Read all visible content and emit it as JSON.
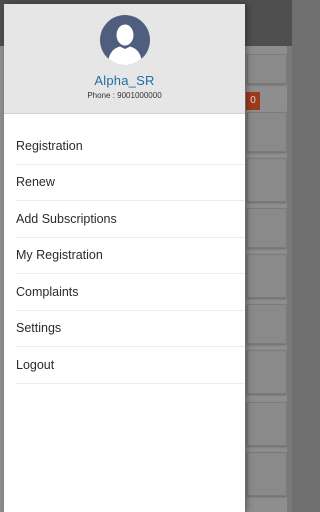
{
  "drawer": {
    "user": {
      "name": "Alpha_SR",
      "phone": "Phone : 9001000000"
    },
    "menu_items": [
      {
        "label": "Registration"
      },
      {
        "label": "Renew"
      },
      {
        "label": "Add Subscriptions"
      },
      {
        "label": "My Registration"
      },
      {
        "label": "Complaints"
      },
      {
        "label": "Settings"
      },
      {
        "label": "Logout"
      }
    ]
  },
  "background": {
    "badge_text": "0"
  },
  "colors": {
    "accent": "#1f6ea6",
    "avatar_bg": "#4f5e7f",
    "header_bg": "#e6e6e6",
    "badge": "#9c3a1e"
  },
  "icons": {
    "avatar": "user-silhouette-icon"
  }
}
